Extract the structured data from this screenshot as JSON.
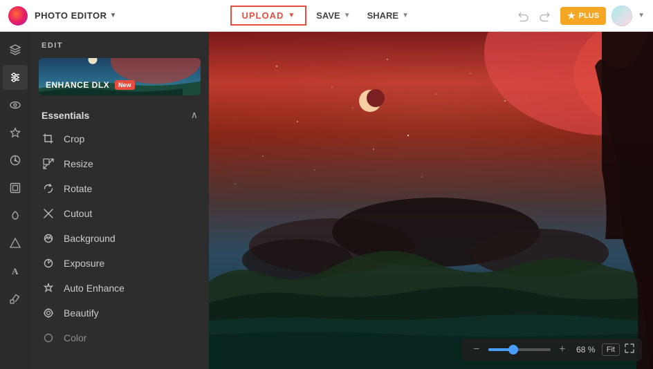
{
  "header": {
    "app_name": "PHOTO EDITOR",
    "app_dropdown": "▼",
    "upload_label": "UPLOAD",
    "upload_arrow": "▼",
    "save_label": "SAVE",
    "save_arrow": "▼",
    "share_label": "SHARE",
    "share_arrow": "▼",
    "undo_icon": "↩",
    "redo_icon": "↪",
    "plus_label": "PLUS",
    "avatar_arrow": "▼"
  },
  "sidebar": {
    "edit_label": "EDIT",
    "banner": {
      "text": "ENHANCE DLX",
      "badge": "New"
    },
    "essentials": {
      "title": "Essentials",
      "arrow": "∧",
      "tools": [
        {
          "name": "Crop",
          "icon": "crop"
        },
        {
          "name": "Resize",
          "icon": "resize"
        },
        {
          "name": "Rotate",
          "icon": "rotate"
        },
        {
          "name": "Cutout",
          "icon": "cutout"
        },
        {
          "name": "Background",
          "icon": "background"
        },
        {
          "name": "Exposure",
          "icon": "exposure"
        },
        {
          "name": "Auto Enhance",
          "icon": "auto-enhance"
        },
        {
          "name": "Beautify",
          "icon": "beautify"
        },
        {
          "name": "Color",
          "icon": "color"
        }
      ]
    }
  },
  "icon_bar": [
    {
      "icon": "layers",
      "label": "Layers",
      "active": false
    },
    {
      "icon": "sliders",
      "label": "Adjustments",
      "active": false
    },
    {
      "icon": "eye",
      "label": "View",
      "active": false
    },
    {
      "icon": "star",
      "label": "Favorites",
      "active": false
    },
    {
      "icon": "settings",
      "label": "Effects",
      "active": false
    },
    {
      "icon": "frame",
      "label": "Frames",
      "active": false
    },
    {
      "icon": "heart",
      "label": "Beauty",
      "active": false
    },
    {
      "icon": "shape",
      "label": "Shapes",
      "active": false
    },
    {
      "icon": "text",
      "label": "Text",
      "active": false
    },
    {
      "icon": "brush",
      "label": "Draw",
      "active": false
    }
  ],
  "bottom_toolbar": {
    "zoom_minus": "−",
    "zoom_plus": "+",
    "zoom_value": "68 %",
    "fit_label": "Fit",
    "zoom_percent": 40
  }
}
